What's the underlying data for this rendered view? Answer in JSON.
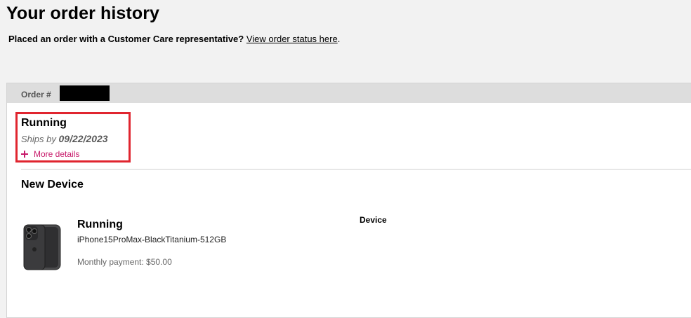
{
  "page": {
    "title": "Your order history",
    "subline_text": "Placed an order with a Customer Care representative?",
    "subline_link": "View order status here",
    "subline_period": "."
  },
  "order": {
    "number_label": "Order #",
    "status": "Running",
    "ships_by_label": "Ships by",
    "ships_by_date": "09/22/2023",
    "more_details_label": "More details",
    "section_title": "New Device",
    "items": [
      {
        "status": "Running",
        "name": "iPhone15ProMax-BlackTitanium-512GB",
        "payment": "Monthly payment: $50.00",
        "type": "Device"
      }
    ]
  },
  "colors": {
    "accent": "#c7196a",
    "highlight_border": "#e0252f",
    "header_bg": "#dddddd",
    "page_bg": "#f2f2f2"
  }
}
